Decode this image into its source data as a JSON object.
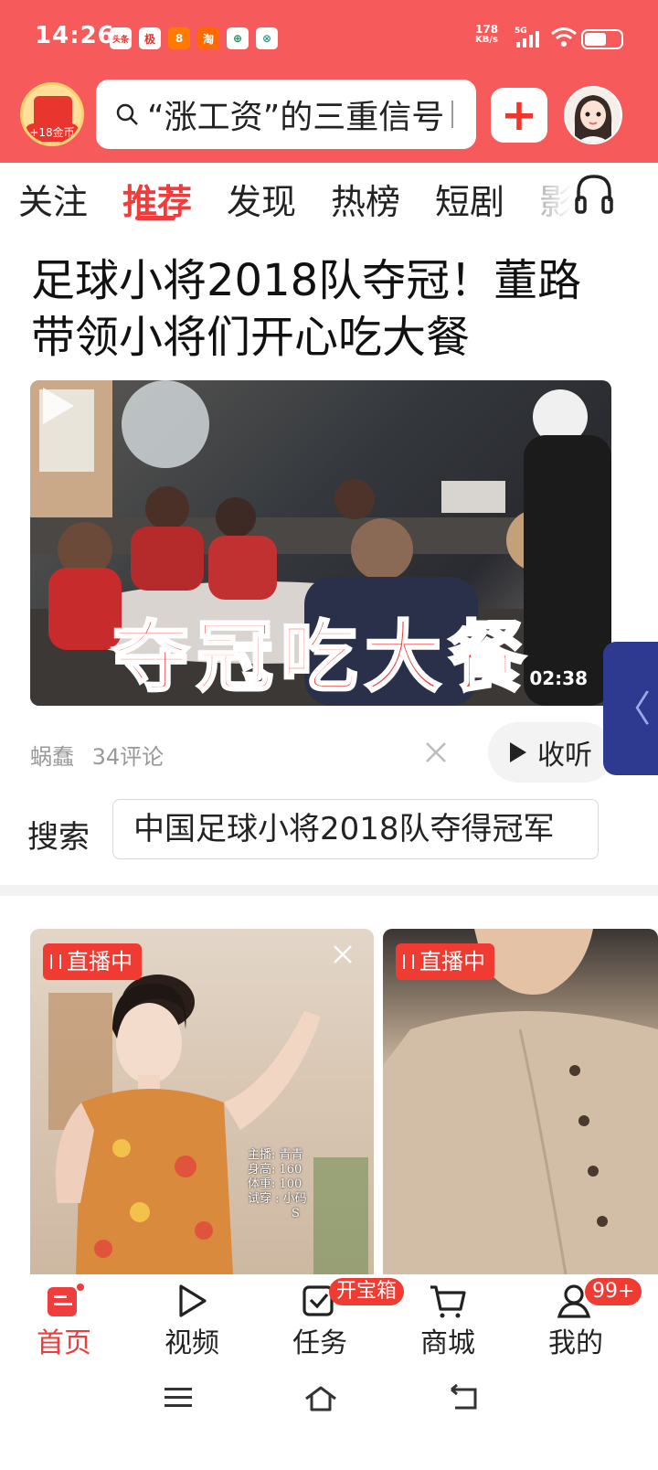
{
  "status_bar": {
    "time": "14:26",
    "app_icons": [
      "头条",
      "极",
      "8",
      "淘",
      "⊕",
      "⊗"
    ],
    "network_speed_value": "178",
    "network_speed_unit": "KB/s",
    "signal_label": "5G",
    "battery_level": 0.6
  },
  "header": {
    "coin_badge": "+18金币",
    "search_text": "“涨工资”的三重信号",
    "plus_label": "+"
  },
  "tabs": [
    {
      "label": "关注",
      "active": false
    },
    {
      "label": "推荐",
      "active": true
    },
    {
      "label": "发现",
      "active": false
    },
    {
      "label": "热榜",
      "active": false
    },
    {
      "label": "短剧",
      "active": false
    },
    {
      "label": "影",
      "active": false
    }
  ],
  "article": {
    "headline": "足球小将2018队夺冠！董路带领小将们开心吃大餐",
    "video_overlay_title": "夺冠吃大餐",
    "duration": "02:38",
    "source": "蜗蠢",
    "comments": "34评论",
    "listen_label": "收听",
    "search_label": "搜索",
    "search_suggestion": "中国足球小将2018队夺得冠军"
  },
  "live_cards": [
    {
      "badge": "直播中",
      "info_lines": [
        "主播: 青青",
        "身高: 160",
        "体重: 100",
        "试穿 : 小码"
      ],
      "info_extra": "S"
    },
    {
      "badge": "直播中"
    }
  ],
  "bottom_nav": {
    "items": [
      {
        "label": "首页",
        "icon": "home-news-icon",
        "active": true
      },
      {
        "label": "视频",
        "icon": "play-icon",
        "active": false
      },
      {
        "label": "任务",
        "icon": "task-check-icon",
        "active": false
      },
      {
        "label": "商城",
        "icon": "cart-icon",
        "active": false
      },
      {
        "label": "我的",
        "icon": "person-icon",
        "active": false
      }
    ],
    "task_badge": "开宝箱",
    "mine_badge": "99+"
  },
  "colors": {
    "brand_red": "#f65a5a",
    "active_red": "#ef3c3c",
    "side_tab": "#2e3a8f"
  }
}
